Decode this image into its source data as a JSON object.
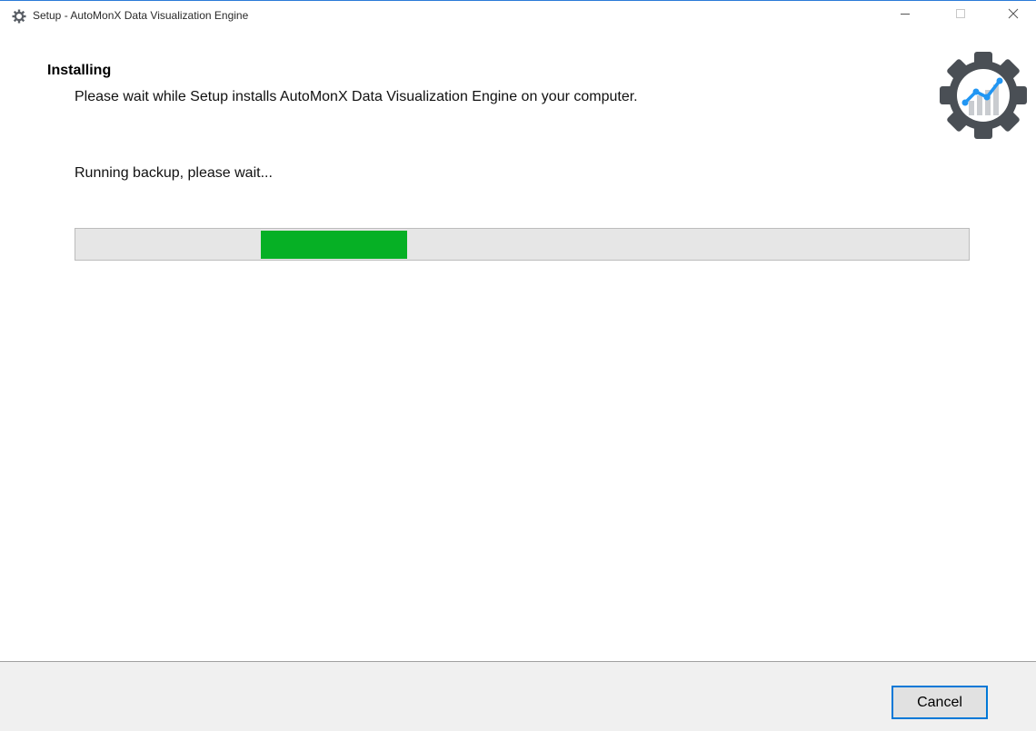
{
  "window": {
    "title": "Setup - AutoMonX Data Visualization Engine",
    "title_icon": "gear-icon",
    "controls": {
      "minimize_icon": "minimize-icon",
      "maximize_icon": "maximize-icon",
      "close_icon": "close-icon"
    }
  },
  "header": {
    "title": "Installing",
    "subtitle": "Please wait while Setup installs AutoMonX Data Visualization Engine on your computer.",
    "logo_icon": "gear-chart-logo"
  },
  "body": {
    "status_text": "Running backup, please wait...",
    "progress": {
      "mode": "indeterminate-marquee",
      "fill_color": "#06b025"
    }
  },
  "footer": {
    "cancel_label": "Cancel"
  },
  "colors": {
    "accent": "#0078d7",
    "progress_green": "#06b025",
    "logo_gear": "#4a4f55",
    "logo_chart": "#2196f3"
  }
}
